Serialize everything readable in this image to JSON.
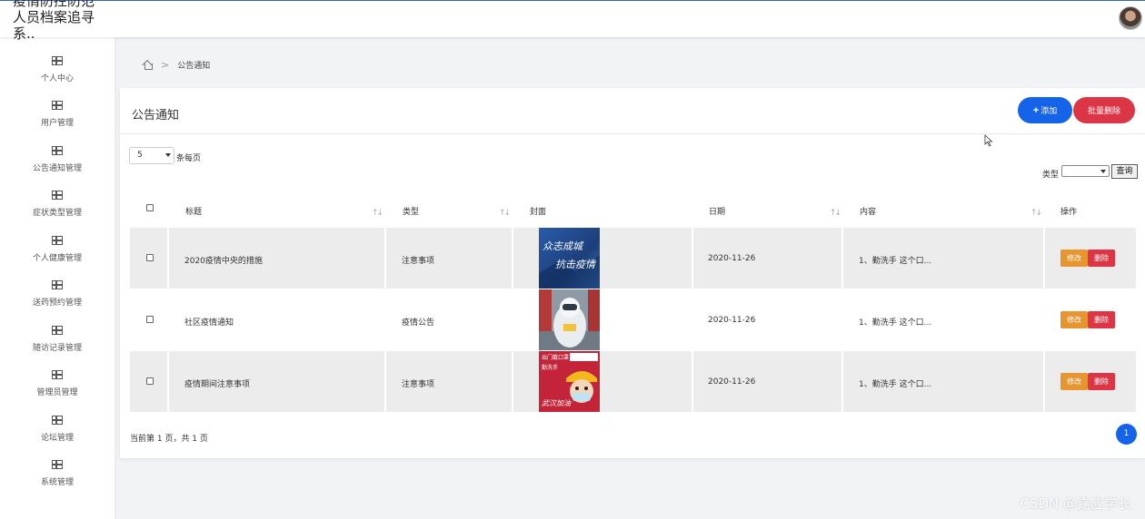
{
  "app": {
    "title": "疫情防控防范人员档案追寻系..",
    "title_lines": [
      "疫情防控防范",
      "人员档案追寻",
      "系.."
    ]
  },
  "sidebar": {
    "items": [
      {
        "label": "个人中心",
        "icon": "grid-icon"
      },
      {
        "label": "用户管理",
        "icon": "grid-icon"
      },
      {
        "label": "公告通知管理",
        "icon": "grid-icon"
      },
      {
        "label": "症状类型管理",
        "icon": "grid-icon"
      },
      {
        "label": "个人健康管理",
        "icon": "grid-icon"
      },
      {
        "label": "送药预约管理",
        "icon": "grid-icon"
      },
      {
        "label": "随访记录管理",
        "icon": "grid-icon"
      },
      {
        "label": "管理员管理",
        "icon": "grid-icon"
      },
      {
        "label": "论坛管理",
        "icon": "grid-icon"
      },
      {
        "label": "系统管理",
        "icon": "grid-icon"
      }
    ]
  },
  "breadcrumb": {
    "current": "公告通知",
    "separator": ">"
  },
  "panel": {
    "title": "公告通知",
    "add_label": "添加",
    "batch_delete_label": "批量删除"
  },
  "pagesize": {
    "value": "5",
    "label": "条每页"
  },
  "filter": {
    "type_label": "类型",
    "type_value": "",
    "query_label": "查询"
  },
  "table": {
    "columns": [
      "标题",
      "类型",
      "封面",
      "日期",
      "内容",
      "操作"
    ],
    "sort_glyph": "↑↓",
    "rows": [
      {
        "title": "2020疫情中央的措施",
        "type": "注意事项",
        "cover_text": [
          "众志成城",
          "抗击疫情"
        ],
        "date": "2020-11-26",
        "content": "1、勤洗手 这个口...",
        "edit": "修改",
        "delete": "删除"
      },
      {
        "title": "社区疫情通知",
        "type": "疫情公告",
        "cover_text": [],
        "date": "2020-11-26",
        "content": "1、勤洗手 这个口...",
        "edit": "修改",
        "delete": "删除"
      },
      {
        "title": "疫情期间注意事项",
        "type": "注意事项",
        "cover_text": [
          "出门戴口罩",
          "勤洗手",
          "武汉加油"
        ],
        "date": "2020-11-26",
        "content": "1、勤洗手 这个口...",
        "edit": "修改",
        "delete": "删除"
      }
    ]
  },
  "pager": {
    "info": "当前第 1 页，共 1 页",
    "current_page": "1"
  },
  "watermark": "CSDN @嘉应学长",
  "colors": {
    "primary": "#1463e8",
    "danger": "#dc3545",
    "warning": "#e6952f"
  }
}
